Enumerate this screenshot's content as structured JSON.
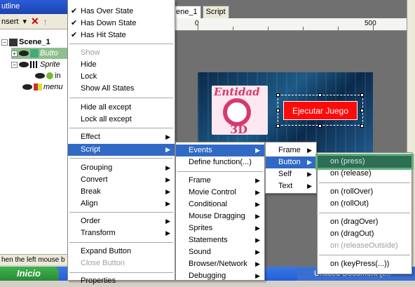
{
  "outline": {
    "title": "utline",
    "toolbar_insert": "nsert",
    "tree": [
      {
        "label": "Scene_1",
        "bold": true
      },
      {
        "label": "Butto",
        "italic": true
      },
      {
        "label": "Sprite",
        "italic": true
      },
      {
        "label": "in"
      },
      {
        "label": "menu",
        "italic": true
      }
    ],
    "status": "hen the left mouse b"
  },
  "stage": {
    "tabs": [
      "ene_1",
      "Script"
    ],
    "ruler": {
      "zero": "0",
      "five_hundred": "500"
    },
    "logo_top": "Entidad",
    "logo_bottom": "3D",
    "button_text": "Ejecutar Juego"
  },
  "context_menu": {
    "items": [
      {
        "label": "Has Over State",
        "checked": true
      },
      {
        "label": "Has Down State",
        "checked": true
      },
      {
        "label": "Has Hit State",
        "checked": true
      },
      {
        "label": "Show",
        "disabled": true
      },
      {
        "label": "Hide"
      },
      {
        "label": "Lock"
      },
      {
        "label": "Show All States"
      },
      {
        "label": "Hide all except"
      },
      {
        "label": "Lock all except"
      },
      {
        "label": "Effect"
      },
      {
        "label": "Script"
      },
      {
        "label": "Grouping"
      },
      {
        "label": "Convert"
      },
      {
        "label": "Break"
      },
      {
        "label": "Align"
      },
      {
        "label": "Order"
      },
      {
        "label": "Transform"
      },
      {
        "label": "Expand Button"
      },
      {
        "label": "Close Button",
        "disabled": true
      },
      {
        "label": "Properties"
      }
    ]
  },
  "script_menu": {
    "items": [
      {
        "label": "Events"
      },
      {
        "label": "Define function(...)"
      },
      {
        "label": "Frame"
      },
      {
        "label": "Movie Control"
      },
      {
        "label": "Conditional"
      },
      {
        "label": "Mouse Dragging"
      },
      {
        "label": "Sprites"
      },
      {
        "label": "Statements"
      },
      {
        "label": "Sound"
      },
      {
        "label": "Browser/Network"
      },
      {
        "label": "Debugging"
      }
    ]
  },
  "events_menu": {
    "items": [
      {
        "label": "Frame"
      },
      {
        "label": "Button"
      },
      {
        "label": "Self"
      },
      {
        "label": "Text"
      }
    ]
  },
  "button_menu": {
    "items": [
      {
        "label": "on (press)"
      },
      {
        "label": "on (release)"
      },
      {
        "label": "on (rollOver)"
      },
      {
        "label": "on (rollOut)"
      },
      {
        "label": "on (dragOver)"
      },
      {
        "label": "on (dragOut)"
      },
      {
        "label": "on (releaseOutside)",
        "disabled": true
      },
      {
        "label": "on (keyPress(...))"
      }
    ]
  },
  "taskbar": {
    "start": "Inicio",
    "task": "Untitled Document (t..."
  },
  "colors": {
    "menu_highlight": "#316ac5",
    "stage_button": "#ff0a0a"
  }
}
